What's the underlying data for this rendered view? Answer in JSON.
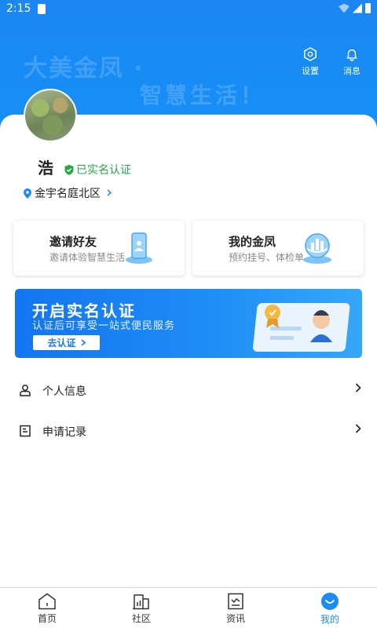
{
  "status_bar": {
    "time": "2:15"
  },
  "header": {
    "slogan_line1": "大美金凤 ·",
    "slogan_line2": "智慧生活！",
    "settings_label": "设置",
    "messages_label": "消息"
  },
  "profile": {
    "name": "浩",
    "verified_label": "已实名认证",
    "location": "金宇名庭北区"
  },
  "tiles": [
    {
      "title": "邀请好友",
      "subtitle": "邀请体验智慧生活"
    },
    {
      "title": "我的金凤",
      "subtitle": "预约挂号、体检单"
    }
  ],
  "banner": {
    "title": "开启实名认证",
    "subtitle": "认证后可享受一站式便民服务",
    "button_label": "去认证"
  },
  "menu": [
    {
      "label": "个人信息"
    },
    {
      "label": "申请记录"
    }
  ],
  "tabbar": {
    "items": [
      {
        "label": "首页"
      },
      {
        "label": "社区"
      },
      {
        "label": "资讯"
      },
      {
        "label": "我的"
      }
    ],
    "active_index": 3
  },
  "colors": {
    "primary": "#1a8cf5",
    "verified": "#27a845",
    "banner_start": "#1375ef",
    "banner_end": "#36a7fa"
  }
}
